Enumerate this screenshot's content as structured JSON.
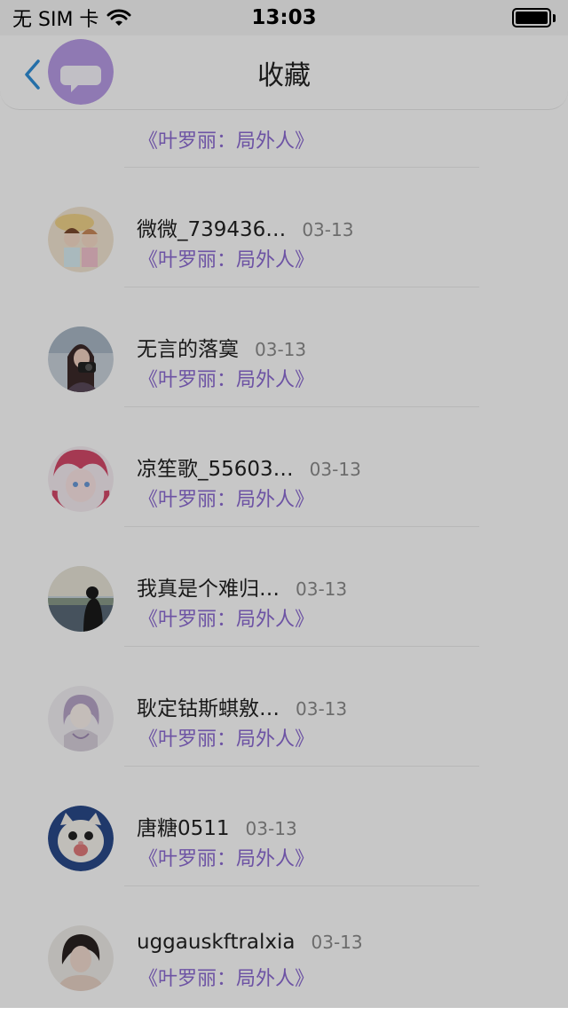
{
  "status_bar": {
    "carrier": "无 SIM 卡",
    "time": "13:03"
  },
  "nav": {
    "title": "收藏"
  },
  "items": [
    {
      "name": "",
      "date": "",
      "book": "《叶罗丽：局外人》"
    },
    {
      "name": "微微_739436…",
      "date": "03-13",
      "book": "《叶罗丽：局外人》"
    },
    {
      "name": "无言的落寞",
      "date": "03-13",
      "book": "《叶罗丽：局外人》"
    },
    {
      "name": "凉笙歌_55603…",
      "date": "03-13",
      "book": "《叶罗丽：局外人》"
    },
    {
      "name": "我真是个难归…",
      "date": "03-13",
      "book": "《叶罗丽：局外人》"
    },
    {
      "name": "耿定钴斯蜞敫…",
      "date": "03-13",
      "book": "《叶罗丽：局外人》"
    },
    {
      "name": "唐糖0511",
      "date": "03-13",
      "book": "《叶罗丽：局外人》"
    },
    {
      "name": "uggauskftralxia",
      "date": "03-13",
      "book": "《叶罗丽：局外人》"
    }
  ],
  "colors": {
    "accent_purple": "#8c6bd2",
    "back_blue": "#2f8fd8"
  }
}
